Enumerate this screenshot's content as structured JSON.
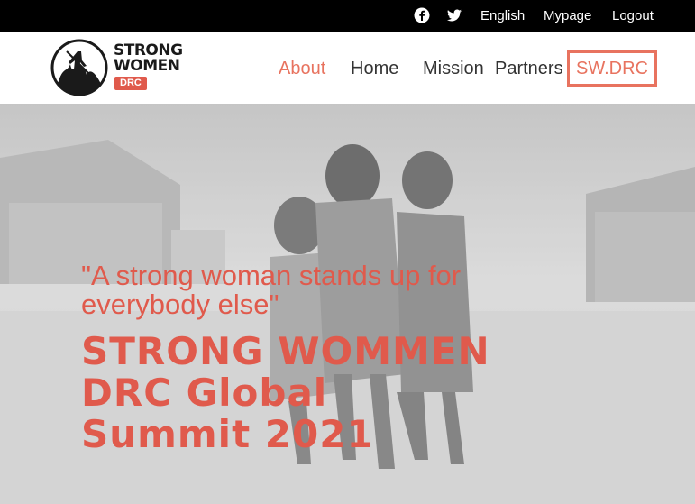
{
  "topbar": {
    "social_icons": [
      "facebook-icon",
      "twitter-icon"
    ],
    "links": {
      "english": "English",
      "mypage": "Mypage",
      "logout": "Logout"
    }
  },
  "logo": {
    "line1": "STRONG",
    "line2": "WOMEN",
    "badge": "DRC"
  },
  "nav": {
    "about": "About",
    "home": "Home",
    "mission": "Mission",
    "partners": "Partners",
    "swdrc": "SW.DRC"
  },
  "hero": {
    "quote": "\"A strong woman stands up for everybody else\"",
    "headline_line1": "STRONG WOMMEN",
    "headline_line2": "DRC Global",
    "headline_line3": "Summit 2021"
  },
  "colors": {
    "accent": "#e05a4c",
    "nav_active": "#e8735f",
    "topbar": "#000000"
  }
}
